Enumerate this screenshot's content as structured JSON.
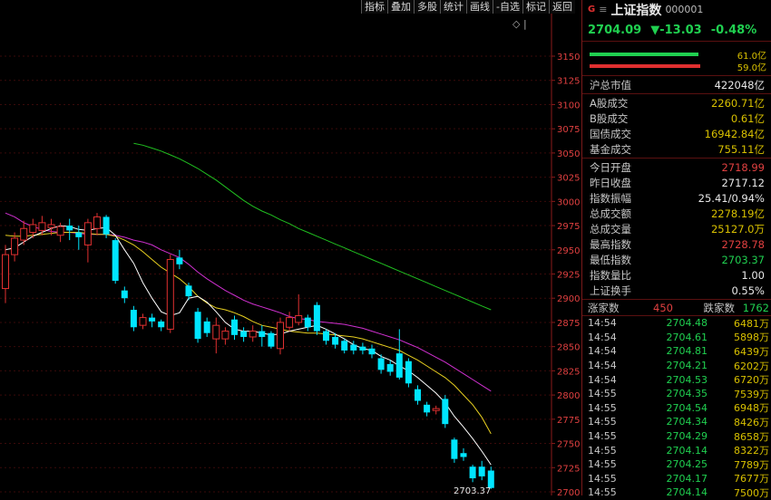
{
  "toolbar": [
    "指标",
    "叠加",
    "多股",
    "统计",
    "画线",
    "-自选",
    "标记",
    "返回"
  ],
  "chart_nav": "◇ |",
  "y_axis": [
    "3150",
    "3125",
    "3100",
    "3075",
    "3050",
    "3025",
    "3000",
    "2975",
    "2950",
    "2925",
    "2900",
    "2875",
    "2850",
    "2825",
    "2800",
    "2775",
    "2750",
    "2725",
    "2700"
  ],
  "low_marker": "2703.37",
  "colors": {
    "up": "#e03030",
    "down": "#00e5ff",
    "ma5": "#ffffff",
    "ma10": "#e8d020",
    "ma20": "#d030d0",
    "ma60": "#20c020"
  },
  "chart_data": {
    "type": "candlestick",
    "ylim": [
      2700,
      3162
    ],
    "candles": [
      {
        "o": 2910,
        "c": 2945,
        "h": 2955,
        "l": 2895
      },
      {
        "o": 2945,
        "c": 2962,
        "h": 2968,
        "l": 2938
      },
      {
        "o": 2960,
        "c": 2972,
        "h": 2980,
        "l": 2955
      },
      {
        "o": 2968,
        "c": 2976,
        "h": 2982,
        "l": 2962
      },
      {
        "o": 2970,
        "c": 2978,
        "h": 2985,
        "l": 2965
      },
      {
        "o": 2973,
        "c": 2976,
        "h": 2982,
        "l": 2965
      },
      {
        "o": 2965,
        "c": 2974,
        "h": 2978,
        "l": 2958
      },
      {
        "o": 2975,
        "c": 2970,
        "h": 2982,
        "l": 2960
      },
      {
        "o": 2968,
        "c": 2963,
        "h": 2975,
        "l": 2950
      },
      {
        "o": 2955,
        "c": 2978,
        "h": 2982,
        "l": 2937
      },
      {
        "o": 2972,
        "c": 2984,
        "h": 2988,
        "l": 2965
      },
      {
        "o": 2984,
        "c": 2966,
        "h": 2986,
        "l": 2962
      },
      {
        "o": 2960,
        "c": 2918,
        "h": 2962,
        "l": 2915
      },
      {
        "o": 2908,
        "c": 2900,
        "h": 2912,
        "l": 2895
      },
      {
        "o": 2888,
        "c": 2870,
        "h": 2892,
        "l": 2866
      },
      {
        "o": 2872,
        "c": 2880,
        "h": 2884,
        "l": 2868
      },
      {
        "o": 2880,
        "c": 2876,
        "h": 2884,
        "l": 2870
      },
      {
        "o": 2876,
        "c": 2870,
        "h": 2878,
        "l": 2866
      },
      {
        "o": 2868,
        "c": 2940,
        "h": 2945,
        "l": 2864
      },
      {
        "o": 2942,
        "c": 2935,
        "h": 2950,
        "l": 2930
      },
      {
        "o": 2913,
        "c": 2902,
        "h": 2916,
        "l": 2898
      },
      {
        "o": 2886,
        "c": 2858,
        "h": 2890,
        "l": 2854
      },
      {
        "o": 2876,
        "c": 2864,
        "h": 2880,
        "l": 2860
      },
      {
        "o": 2858,
        "c": 2872,
        "h": 2880,
        "l": 2843
      },
      {
        "o": 2858,
        "c": 2866,
        "h": 2870,
        "l": 2852
      },
      {
        "o": 2878,
        "c": 2862,
        "h": 2882,
        "l": 2857
      },
      {
        "o": 2866,
        "c": 2860,
        "h": 2870,
        "l": 2855
      },
      {
        "o": 2860,
        "c": 2866,
        "h": 2872,
        "l": 2855
      },
      {
        "o": 2866,
        "c": 2860,
        "h": 2872,
        "l": 2850
      },
      {
        "o": 2864,
        "c": 2850,
        "h": 2866,
        "l": 2848
      },
      {
        "o": 2848,
        "c": 2875,
        "h": 2880,
        "l": 2842
      },
      {
        "o": 2870,
        "c": 2880,
        "h": 2886,
        "l": 2866
      },
      {
        "o": 2875,
        "c": 2882,
        "h": 2904,
        "l": 2872
      },
      {
        "o": 2880,
        "c": 2870,
        "h": 2883,
        "l": 2866
      },
      {
        "o": 2893,
        "c": 2866,
        "h": 2896,
        "l": 2862
      },
      {
        "o": 2866,
        "c": 2856,
        "h": 2868,
        "l": 2852
      },
      {
        "o": 2860,
        "c": 2852,
        "h": 2864,
        "l": 2848
      },
      {
        "o": 2856,
        "c": 2846,
        "h": 2858,
        "l": 2843
      },
      {
        "o": 2852,
        "c": 2846,
        "h": 2856,
        "l": 2842
      },
      {
        "o": 2850,
        "c": 2846,
        "h": 2854,
        "l": 2842
      },
      {
        "o": 2848,
        "c": 2842,
        "h": 2852,
        "l": 2838
      },
      {
        "o": 2838,
        "c": 2826,
        "h": 2842,
        "l": 2822
      },
      {
        "o": 2832,
        "c": 2824,
        "h": 2836,
        "l": 2820
      },
      {
        "o": 2843,
        "c": 2818,
        "h": 2868,
        "l": 2816
      },
      {
        "o": 2835,
        "c": 2812,
        "h": 2838,
        "l": 2808
      },
      {
        "o": 2806,
        "c": 2794,
        "h": 2810,
        "l": 2790
      },
      {
        "o": 2790,
        "c": 2782,
        "h": 2793,
        "l": 2778
      },
      {
        "o": 2784,
        "c": 2786,
        "h": 2789,
        "l": 2780
      },
      {
        "o": 2796,
        "c": 2770,
        "h": 2800,
        "l": 2766
      },
      {
        "o": 2754,
        "c": 2734,
        "h": 2756,
        "l": 2730
      },
      {
        "o": 2740,
        "c": 2736,
        "h": 2745,
        "l": 2732
      },
      {
        "o": 2726,
        "c": 2714,
        "h": 2728,
        "l": 2710
      },
      {
        "o": 2726,
        "c": 2716,
        "h": 2732,
        "l": 2712
      },
      {
        "o": 2722,
        "c": 2704,
        "h": 2726,
        "l": 2703
      }
    ],
    "ma5": [
      2950,
      2952,
      2958,
      2964,
      2968,
      2972,
      2975,
      2974,
      2971,
      2970,
      2972,
      2973,
      2965,
      2950,
      2936,
      2916,
      2900,
      2886,
      2882,
      2885,
      2900,
      2902,
      2896,
      2886,
      2875,
      2868,
      2866,
      2866,
      2864,
      2862,
      2863,
      2866,
      2868,
      2870,
      2872,
      2868,
      2863,
      2858,
      2852,
      2848,
      2846,
      2840,
      2836,
      2830,
      2825,
      2818,
      2810,
      2802,
      2792,
      2778,
      2767,
      2755,
      2742,
      2728
    ],
    "ma10": [
      2965,
      2964,
      2964,
      2965,
      2966,
      2967,
      2968,
      2968,
      2968,
      2967,
      2966,
      2966,
      2964,
      2960,
      2955,
      2948,
      2940,
      2932,
      2926,
      2920,
      2912,
      2902,
      2895,
      2890,
      2888,
      2885,
      2881,
      2876,
      2872,
      2870,
      2868,
      2866,
      2865,
      2864,
      2864,
      2863,
      2862,
      2861,
      2860,
      2858,
      2855,
      2852,
      2849,
      2846,
      2841,
      2836,
      2830,
      2824,
      2818,
      2810,
      2800,
      2790,
      2777,
      2760
    ],
    "ma20": [
      2988,
      2984,
      2978,
      2974,
      2971,
      2969,
      2968,
      2968,
      2967,
      2966,
      2966,
      2966,
      2965,
      2963,
      2960,
      2958,
      2955,
      2950,
      2946,
      2942,
      2935,
      2927,
      2920,
      2914,
      2908,
      2903,
      2898,
      2894,
      2891,
      2888,
      2885,
      2881,
      2879,
      2878,
      2876,
      2875,
      2874,
      2873,
      2871,
      2869,
      2866,
      2863,
      2860,
      2857,
      2853,
      2849,
      2844,
      2839,
      2834,
      2828,
      2822,
      2816,
      2810,
      2804
    ],
    "ma60": [
      3060,
      3058,
      3055,
      3052,
      3048,
      3044,
      3039,
      3034,
      3028,
      3022,
      3015,
      3008,
      3001,
      2995,
      2990,
      2986,
      2981,
      2977,
      2972,
      2968,
      2964,
      2960,
      2956,
      2952,
      2948,
      2944,
      2940,
      2936,
      2932,
      2928,
      2924,
      2920,
      2916,
      2912,
      2908,
      2904,
      2900,
      2896,
      2892,
      2888
    ],
    "ma60_offset": 14
  },
  "panel": {
    "header": {
      "g": "G",
      "menu": "≡",
      "name": "上证指数",
      "code": "000001"
    },
    "quote": {
      "price": "2704.09",
      "change": "▼-13.03",
      "pct": "-0.48%"
    },
    "flow": [
      {
        "label": "61.0亿",
        "color": "#20d050"
      },
      {
        "label": "59.0亿",
        "color": "#e03030"
      }
    ],
    "sec1": [
      {
        "k": "沪总市值",
        "v": "422048亿",
        "c": "c-w"
      }
    ],
    "sec2": [
      {
        "k": "A股成交",
        "v": "2260.71亿",
        "c": "c-y"
      },
      {
        "k": "B股成交",
        "v": "0.61亿",
        "c": "c-y"
      },
      {
        "k": "国债成交",
        "v": "16942.84亿",
        "c": "c-y"
      },
      {
        "k": "基金成交",
        "v": "755.11亿",
        "c": "c-y"
      }
    ],
    "sec3": [
      {
        "k": "今日开盘",
        "v": "2718.99",
        "c": "c-r"
      },
      {
        "k": "昨日收盘",
        "v": "2717.12",
        "c": "c-w"
      },
      {
        "k": "指数振幅",
        "v": "25.41/0.94%",
        "c": "c-w"
      },
      {
        "k": "总成交额",
        "v": "2278.19亿",
        "c": "c-y"
      },
      {
        "k": "总成交量",
        "v": "25127.0万",
        "c": "c-y"
      },
      {
        "k": "最高指数",
        "v": "2728.78",
        "c": "c-r"
      },
      {
        "k": "最低指数",
        "v": "2703.37",
        "c": "c-g"
      },
      {
        "k": "指数量比",
        "v": "1.00",
        "c": "c-w"
      },
      {
        "k": "上证换手",
        "v": "0.55%",
        "c": "c-w"
      }
    ],
    "updown": {
      "up_label": "涨家数",
      "up": "450",
      "down_label": "跌家数",
      "down": "1762"
    },
    "ticks": [
      {
        "t": "14:54",
        "p": "2704.48",
        "v": "6481万"
      },
      {
        "t": "14:54",
        "p": "2704.61",
        "v": "5898万"
      },
      {
        "t": "14:54",
        "p": "2704.81",
        "v": "6439万"
      },
      {
        "t": "14:54",
        "p": "2704.21",
        "v": "6202万"
      },
      {
        "t": "14:54",
        "p": "2704.53",
        "v": "6720万"
      },
      {
        "t": "14:55",
        "p": "2704.35",
        "v": "7539万"
      },
      {
        "t": "14:55",
        "p": "2704.54",
        "v": "6948万"
      },
      {
        "t": "14:55",
        "p": "2704.34",
        "v": "8426万"
      },
      {
        "t": "14:55",
        "p": "2704.29",
        "v": "8658万"
      },
      {
        "t": "14:55",
        "p": "2704.14",
        "v": "8322万"
      },
      {
        "t": "14:55",
        "p": "2704.25",
        "v": "7789万"
      },
      {
        "t": "14:55",
        "p": "2704.17",
        "v": "7677万"
      },
      {
        "t": "14:55",
        "p": "2704.14",
        "v": "7500万"
      }
    ]
  }
}
